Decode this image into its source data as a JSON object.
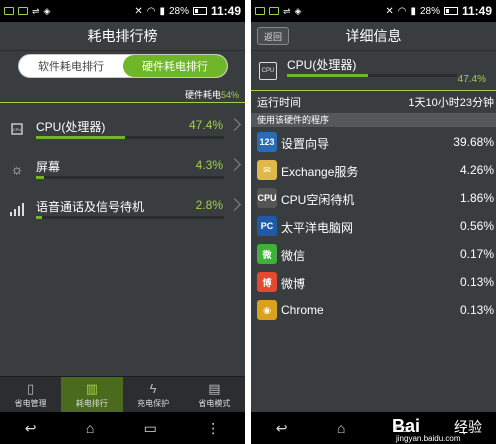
{
  "status_bar": {
    "battery": "28%",
    "time": "11:49"
  },
  "left": {
    "title": "耗电排行榜",
    "tabs": [
      "软件耗电排行",
      "硬件耗电排行"
    ],
    "usage_label": "硬件耗电",
    "usage_pct": "54%",
    "hardware": [
      {
        "name": "CPU(处理器)",
        "pct": "47.4%",
        "fill": 0.474,
        "icon": "cpu-icon"
      },
      {
        "name": "屏幕",
        "pct": "4.3%",
        "fill": 0.043,
        "icon": "brightness-icon"
      },
      {
        "name": "语音通话及信号待机",
        "pct": "2.8%",
        "fill": 0.028,
        "icon": "signal-icon"
      }
    ],
    "nav": [
      {
        "label": "省电管理",
        "icon": "battery-icon"
      },
      {
        "label": "耗电排行",
        "icon": "bar-chart-icon"
      },
      {
        "label": "充电保护",
        "icon": "lightning-icon"
      },
      {
        "label": "省电模式",
        "icon": "mode-icon"
      }
    ]
  },
  "right": {
    "back": "返回",
    "title": "详细信息",
    "cpu": {
      "name": "CPU(处理器)",
      "pct": "47.4%",
      "fill": 0.474
    },
    "runtime_label": "运行时间",
    "runtime_value": "1天10小时23分钟",
    "section": "使用该硬件的程序",
    "apps": [
      {
        "name": "设置向导",
        "pct": "39.68%",
        "icon_text": "123",
        "color": "#2a6bb8"
      },
      {
        "name": "Exchange服务",
        "pct": "4.26%",
        "icon_text": "✉",
        "color": "#e0b84a"
      },
      {
        "name": "CPU空闲待机",
        "pct": "1.86%",
        "icon_text": "CPU",
        "color": "#555"
      },
      {
        "name": "太平洋电脑网",
        "pct": "0.56%",
        "icon_text": "PC",
        "color": "#1f5aa8"
      },
      {
        "name": "微信",
        "pct": "0.17%",
        "icon_text": "微",
        "color": "#3db13a"
      },
      {
        "name": "微博",
        "pct": "0.13%",
        "icon_text": "博",
        "color": "#e2492f"
      },
      {
        "name": "Chrome",
        "pct": "0.13%",
        "icon_text": "◉",
        "color": "#d9a21e"
      }
    ]
  },
  "watermark": {
    "logo": "Bai",
    "logo2": "经验",
    "url": "jingyan.baidu.com"
  }
}
